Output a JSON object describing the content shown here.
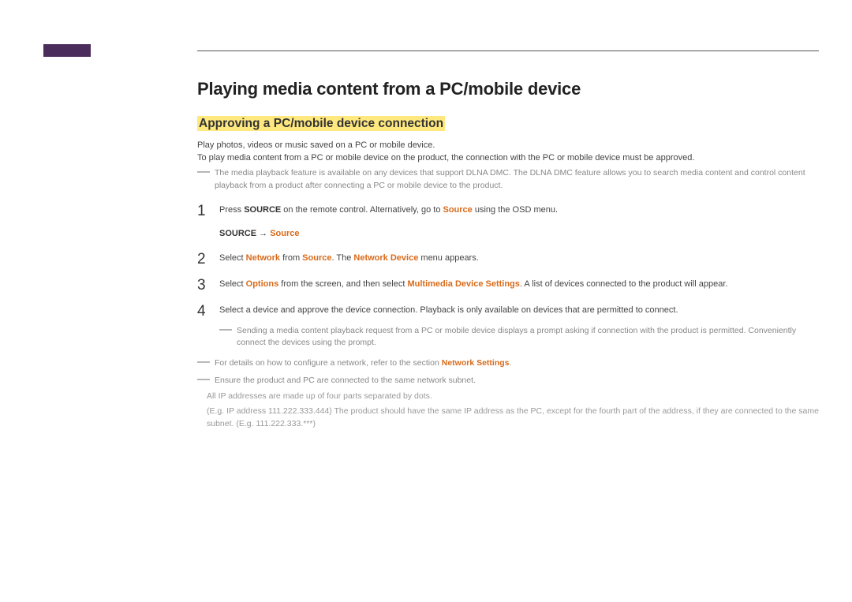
{
  "heading": "Playing media content from a PC/mobile device",
  "subheading": "Approving a PC/mobile device connection",
  "intro1": "Play photos, videos or music saved on a PC or mobile device.",
  "intro2": "To play media content from a PC or mobile device on the product, the connection with the PC or mobile device must be approved.",
  "note_top": "The media playback feature is available on any devices that support DLNA DMC. The DLNA DMC feature allows you to search media content and control content playback from a product after connecting a PC or mobile device to the product.",
  "steps": {
    "1": {
      "pre": "Press ",
      "b1": "SOURCE",
      "mid1": " on the remote control. Alternatively, go to ",
      "o1": "Source",
      "post1": " using the OSD menu.",
      "path_b": "SOURCE",
      "path_arrow": " → ",
      "path_o": "Source"
    },
    "2": {
      "pre": "Select ",
      "o1": "Network",
      "mid1": " from ",
      "o2": "Source",
      "mid2": ". The ",
      "o3": "Network Device",
      "post": " menu appears."
    },
    "3": {
      "pre": "Select ",
      "o1": "Options",
      "mid1": " from the screen, and then select ",
      "o2": "Multimedia Device Settings",
      "post": ". A list of devices connected to the product will appear."
    },
    "4": {
      "text": "Select a device and approve the device connection. Playback is only available on devices that are permitted to connect."
    }
  },
  "note_send": "Sending a media content playback request from a PC or mobile device displays a prompt asking if connection with the product is permitted. Conveniently connect the devices using the prompt.",
  "note_cfg_pre": "For details on how to configure a network, refer to the section ",
  "note_cfg_link": "Network Settings",
  "note_cfg_post": ".",
  "note_subnet": "Ensure the product and PC are connected to the same network subnet.",
  "note_ip1": "All IP addresses are made up of four parts separated by dots.",
  "note_ip2": "(E.g. IP address 111.222.333.444) The product should have the same IP address as the PC, except for the fourth part of the address, if they are connected to the same subnet. (E.g. 111.222.333.***)"
}
